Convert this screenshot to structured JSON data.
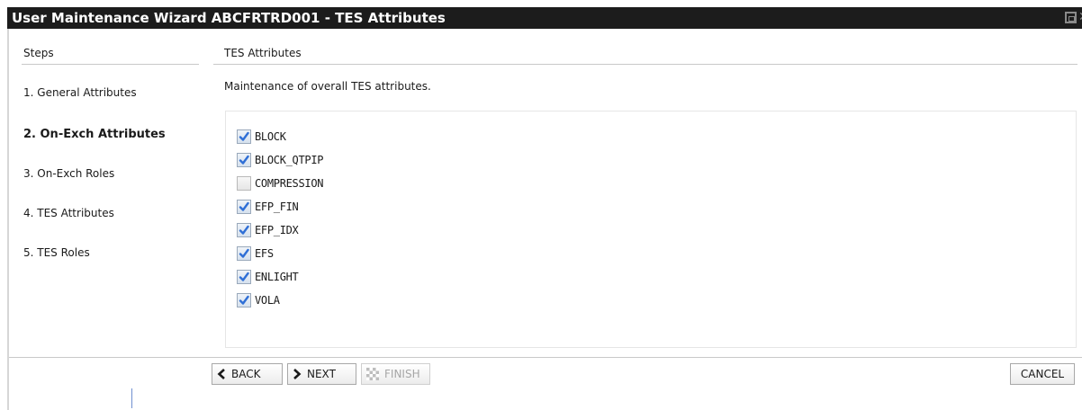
{
  "window": {
    "title": "User Maintenance Wizard ABCFRTRD001 - TES Attributes",
    "icons": [
      "restore-icon",
      "close-icon"
    ]
  },
  "steps": {
    "header": "Steps",
    "items": [
      {
        "label": "1. General Attributes",
        "active": false
      },
      {
        "label": "2. On-Exch Attributes",
        "active": true
      },
      {
        "label": "3. On-Exch Roles",
        "active": false
      },
      {
        "label": "4. TES Attributes",
        "active": false
      },
      {
        "label": "5. TES Roles",
        "active": false
      }
    ]
  },
  "main": {
    "header": "TES Attributes",
    "description": "Maintenance of overall TES attributes.",
    "attributes": [
      {
        "label": "BLOCK",
        "checked": true
      },
      {
        "label": "BLOCK_QTPIP",
        "checked": true
      },
      {
        "label": "COMPRESSION",
        "checked": false
      },
      {
        "label": "EFP_FIN",
        "checked": true
      },
      {
        "label": "EFP_IDX",
        "checked": true
      },
      {
        "label": "EFS",
        "checked": true
      },
      {
        "label": "ENLIGHT",
        "checked": true
      },
      {
        "label": "VOLA",
        "checked": true
      }
    ]
  },
  "buttons": {
    "back": {
      "label": "BACK",
      "icon": "chevron-left-icon",
      "enabled": true
    },
    "next": {
      "label": "NEXT",
      "icon": "chevron-right-icon",
      "enabled": true
    },
    "finish": {
      "label": "FINISH",
      "icon": "checkered-flag-icon",
      "enabled": false
    },
    "cancel": {
      "label": "CANCEL",
      "enabled": true
    }
  },
  "colors": {
    "titlebar": "#1c1c1c",
    "checkmark": "#2f6fd6"
  }
}
